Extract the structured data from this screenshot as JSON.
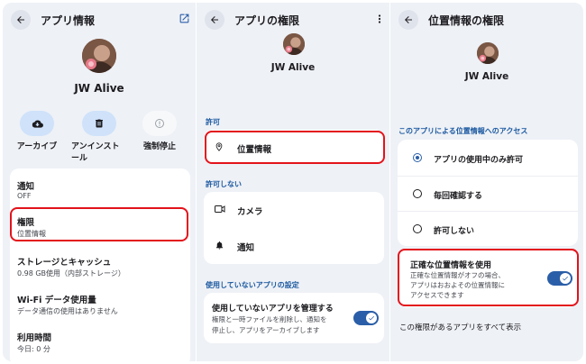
{
  "app": {
    "name": "JW Alive"
  },
  "colors": {
    "accent": "#2a5ea8",
    "section": "#1a58a0",
    "highlight": "#e3131b",
    "action_bg": "#cfe2fa"
  },
  "panel_app_info": {
    "title": "アプリ情報",
    "actions": [
      {
        "label": "アーカイブ",
        "icon": "archive-icon"
      },
      {
        "label": "アンインストール",
        "label_line2": "ール",
        "label_line1": "アンインスト",
        "icon": "trash-icon"
      },
      {
        "label": "強制停止",
        "icon": "stop-icon"
      }
    ],
    "items": [
      {
        "title": "通知",
        "subtitle": "OFF"
      },
      {
        "title": "権限",
        "subtitle": "位置情報"
      },
      {
        "title": "ストレージとキャッシュ",
        "subtitle": "0.98 GB使用（内部ストレージ）"
      },
      {
        "title": "Wi-Fi データ使用量",
        "subtitle": "データ通信の使用はありません"
      },
      {
        "title": "利用時間",
        "subtitle": "今日: 0 分"
      }
    ]
  },
  "panel_permissions": {
    "title": "アプリの権限",
    "allowed_header": "許可",
    "allowed": [
      {
        "label": "位置情報",
        "icon": "location-pin-icon"
      }
    ],
    "denied_header": "許可しない",
    "denied": [
      {
        "label": "カメラ",
        "icon": "camera-icon"
      },
      {
        "label": "通知",
        "icon": "bell-icon"
      }
    ],
    "unused_header": "使用していないアプリの設定",
    "unused": {
      "title": "使用していないアプリを管理する",
      "desc_line1": "権限と一時ファイルを削除し、通知を",
      "desc_line2": "停止し、アプリをアーカイブします",
      "enabled": true
    }
  },
  "panel_location": {
    "title": "位置情報の権限",
    "access_header": "このアプリによる位置情報へのアクセス",
    "options": [
      {
        "label": "アプリの使用中のみ許可",
        "selected": true
      },
      {
        "label": "毎回確認する",
        "selected": false
      },
      {
        "label": "許可しない",
        "selected": false
      }
    ],
    "precise": {
      "title": "正確な位置情報を使用",
      "desc_line1": "正確な位置情報がオフの場合、",
      "desc_line2": "アプリはおおよその位置情報に",
      "desc_line3": "アクセスできます",
      "enabled": true
    },
    "footer_link": "この権限があるアプリをすべて表示"
  }
}
